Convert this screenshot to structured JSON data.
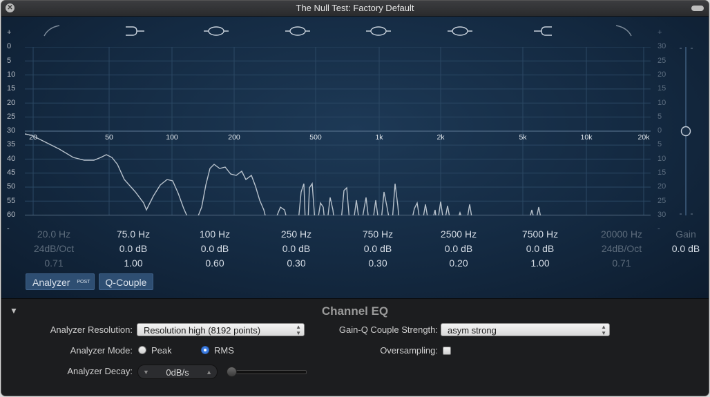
{
  "window": {
    "title": "The Null Test: Factory Default"
  },
  "graph": {
    "db_scale_left": [
      "+",
      "0",
      "5",
      "10",
      "15",
      "20",
      "25",
      "30",
      "35",
      "40",
      "45",
      "50",
      "55",
      "60",
      "-"
    ],
    "db_scale_right": [
      "+",
      "30",
      "25",
      "20",
      "15",
      "10",
      "5",
      "0",
      "5",
      "10",
      "15",
      "20",
      "25",
      "30",
      "-"
    ],
    "freq_labels": [
      "20",
      "50",
      "100",
      "200",
      "500",
      "1k",
      "2k",
      "5k",
      "10k",
      "20k"
    ]
  },
  "bands": [
    {
      "freq": "20.0 Hz",
      "gain": "24dB/Oct",
      "q": "0.71",
      "enabled": false
    },
    {
      "freq": "75.0 Hz",
      "gain": "0.0 dB",
      "q": "1.00",
      "enabled": true
    },
    {
      "freq": "100 Hz",
      "gain": "0.0 dB",
      "q": "0.60",
      "enabled": true
    },
    {
      "freq": "250 Hz",
      "gain": "0.0 dB",
      "q": "0.30",
      "enabled": true
    },
    {
      "freq": "750 Hz",
      "gain": "0.0 dB",
      "q": "0.30",
      "enabled": true
    },
    {
      "freq": "2500 Hz",
      "gain": "0.0 dB",
      "q": "0.20",
      "enabled": true
    },
    {
      "freq": "7500 Hz",
      "gain": "0.0 dB",
      "q": "1.00",
      "enabled": true
    },
    {
      "freq": "20000 Hz",
      "gain": "24dB/Oct",
      "q": "0.71",
      "enabled": false
    }
  ],
  "master_gain": {
    "label": "Gain",
    "value": "0.0 dB"
  },
  "buttons": {
    "analyzer": "Analyzer",
    "analyzer_badge": "POST",
    "q_couple": "Q-Couple"
  },
  "extended": {
    "section_title": "Channel EQ",
    "analyzer_resolution": {
      "label": "Analyzer Resolution:",
      "value": "Resolution high (8192 points)"
    },
    "gain_q_couple": {
      "label": "Gain-Q Couple Strength:",
      "value": "asym strong"
    },
    "analyzer_mode": {
      "label": "Analyzer Mode:",
      "options": [
        "Peak",
        "RMS"
      ],
      "selected": "RMS"
    },
    "oversampling": {
      "label": "Oversampling:",
      "checked": false
    },
    "analyzer_decay": {
      "label": "Analyzer Decay:",
      "value": "0dB/s"
    }
  },
  "colors": {
    "accent": "#3b7be0",
    "curve": "#b8c2cc",
    "panel": "#142a42"
  }
}
